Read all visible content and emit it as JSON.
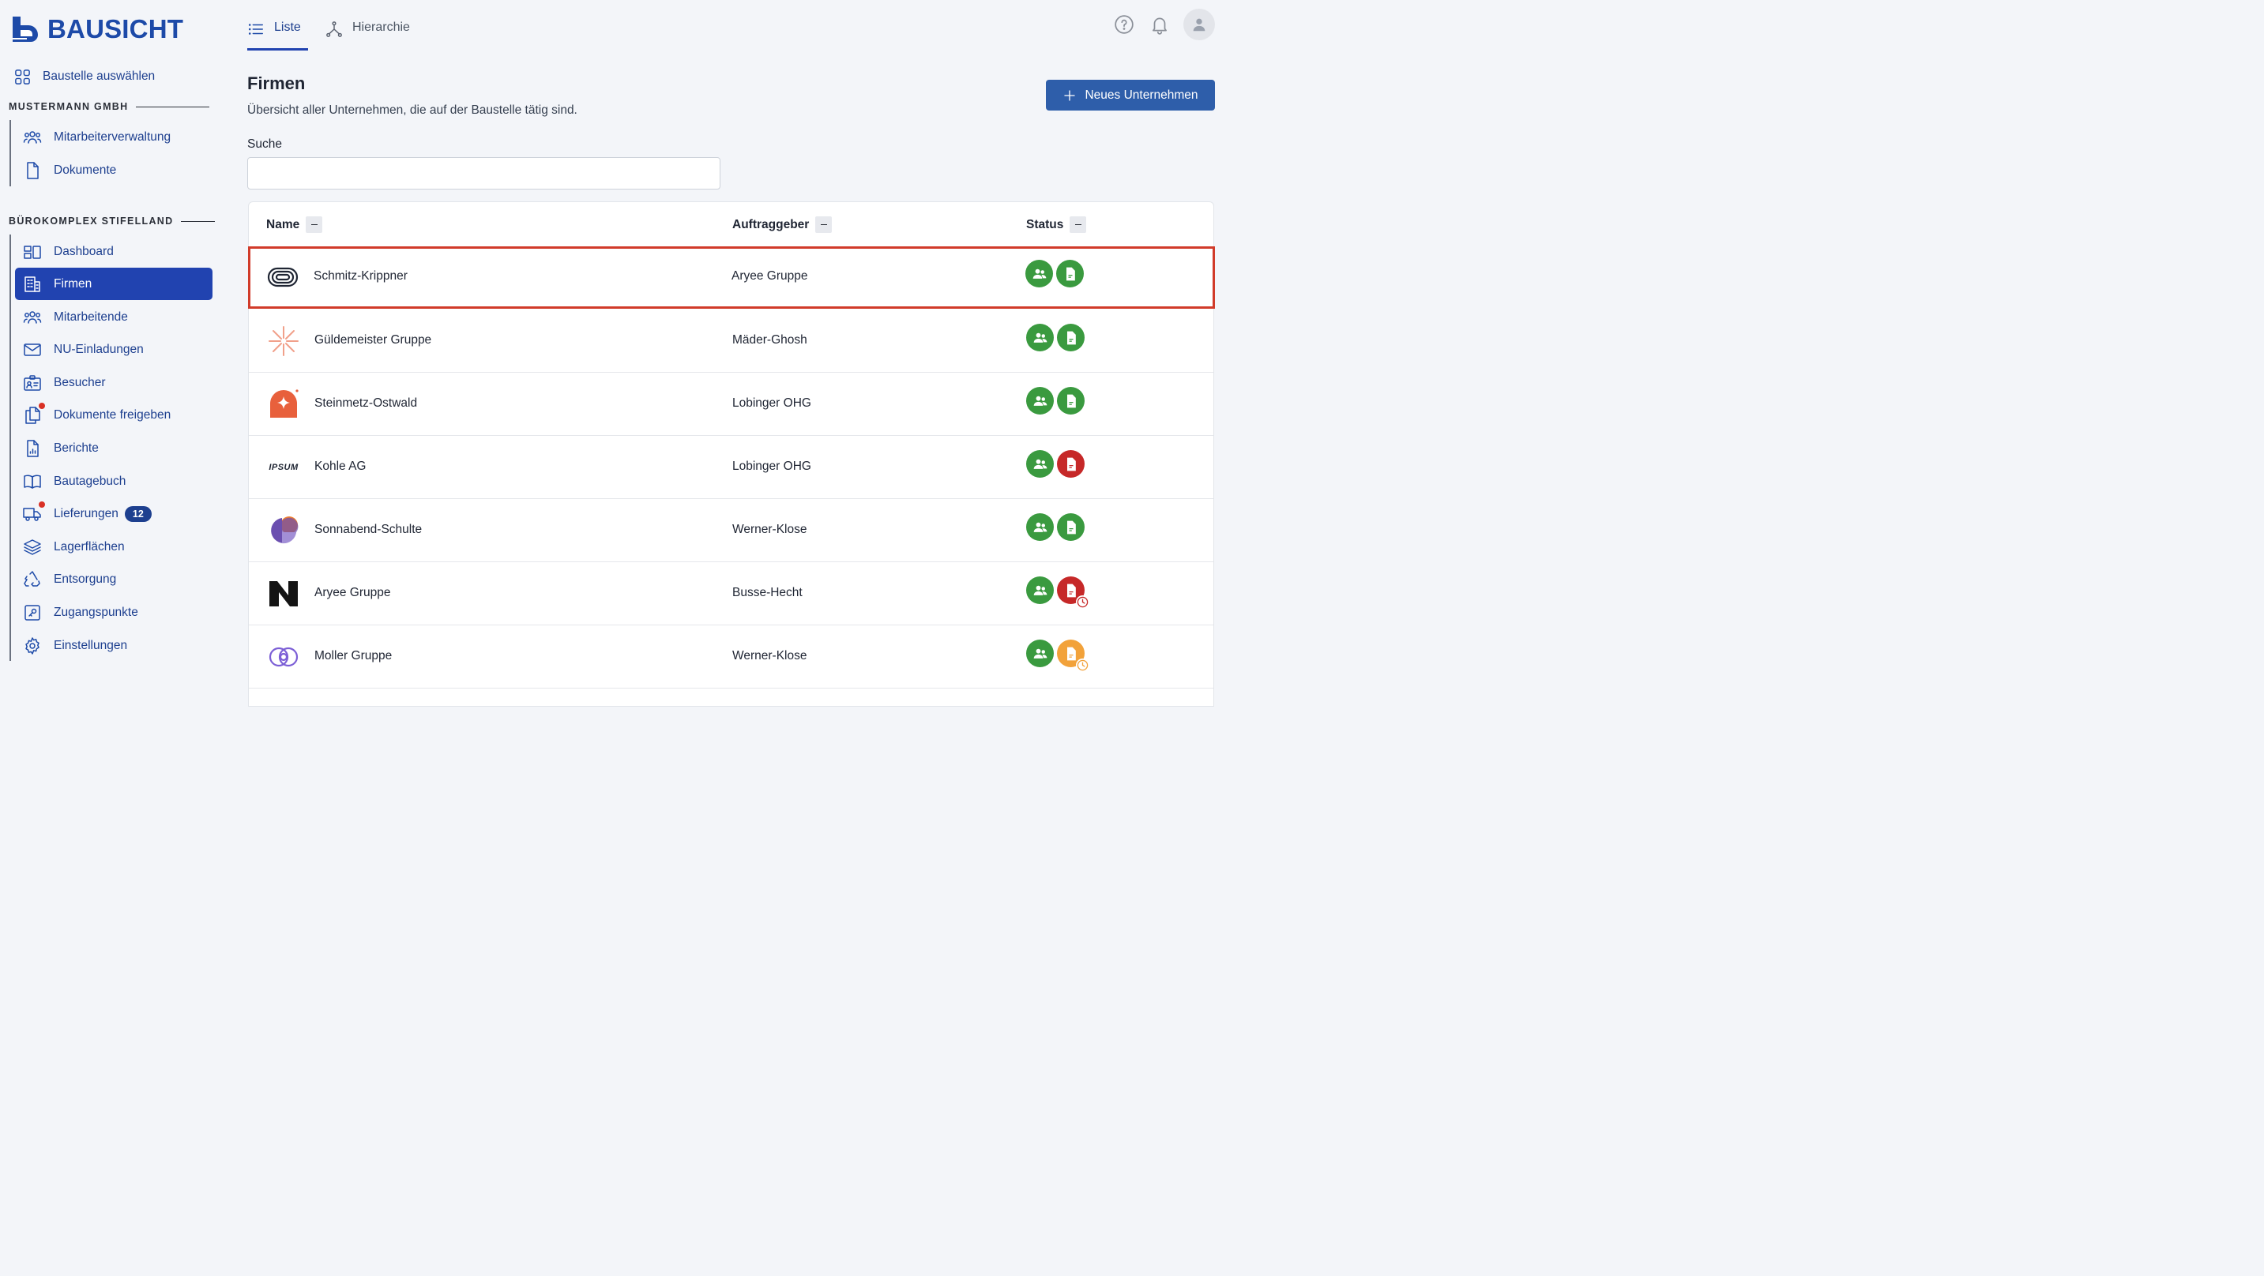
{
  "brand": {
    "name": "BAUSICHT",
    "color": "#1d4aa8"
  },
  "sidebar": {
    "select_site": "Baustelle auswählen",
    "org_section": {
      "label": "MUSTERMANN GMBH",
      "items": [
        {
          "label": "Mitarbeiterverwaltung",
          "icon": "users-icon"
        },
        {
          "label": "Dokumente",
          "icon": "document-icon"
        }
      ]
    },
    "site_section": {
      "label": "BÜROKOMPLEX STIFELLAND",
      "items": [
        {
          "label": "Dashboard",
          "icon": "dashboard-icon"
        },
        {
          "label": "Firmen",
          "icon": "building-icon",
          "active": true
        },
        {
          "label": "Mitarbeitende",
          "icon": "users-icon"
        },
        {
          "label": "NU-Einladungen",
          "icon": "mail-icon"
        },
        {
          "label": "Besucher",
          "icon": "visitor-badge-icon"
        },
        {
          "label": "Dokumente freigeben",
          "icon": "documents-icon",
          "notification_dot": true
        },
        {
          "label": "Berichte",
          "icon": "report-icon"
        },
        {
          "label": "Bautagebuch",
          "icon": "book-icon"
        },
        {
          "label": "Lieferungen",
          "icon": "truck-icon",
          "notification_dot": true,
          "badge": "12"
        },
        {
          "label": "Lagerflächen",
          "icon": "layers-icon"
        },
        {
          "label": "Entsorgung",
          "icon": "recycle-icon"
        },
        {
          "label": "Zugangspunkte",
          "icon": "key-icon"
        },
        {
          "label": "Einstellungen",
          "icon": "gear-icon"
        }
      ]
    }
  },
  "topbar": {
    "tabs": [
      {
        "label": "Liste",
        "icon": "list-icon",
        "active": true
      },
      {
        "label": "Hierarchie",
        "icon": "hierarchy-icon",
        "active": false
      }
    ],
    "icons": [
      "help-icon",
      "bell-icon",
      "avatar-icon"
    ]
  },
  "page": {
    "title": "Firmen",
    "subtitle": "Übersicht aller Unternehmen, die auf der Baustelle tätig sind.",
    "new_button": "Neues Unternehmen",
    "search_label": "Suche",
    "search_value": ""
  },
  "table": {
    "columns": [
      "Name",
      "Auftraggeber",
      "Status"
    ],
    "rows": [
      {
        "name": "Schmitz-Krippner",
        "client": "Aryee Gruppe",
        "logo": "rings-logo",
        "status_people": "green",
        "status_docs": "green",
        "highlighted": true
      },
      {
        "name": "Güldemeister Gruppe",
        "client": "Mäder-Ghosh",
        "logo": "starburst-logo",
        "status_people": "green",
        "status_docs": "green"
      },
      {
        "name": "Steinmetz-Ostwald",
        "client": "Lobinger OHG",
        "logo": "orange-sparkle-logo",
        "status_people": "green",
        "status_docs": "green"
      },
      {
        "name": "Kohle AG",
        "client": "Lobinger OHG",
        "logo": "ipsum-logo",
        "logo_text": "IPSUM",
        "status_people": "green",
        "status_docs": "red"
      },
      {
        "name": "Sonnabend-Schulte",
        "client": "Werner-Klose",
        "logo": "circles-logo",
        "status_people": "green",
        "status_docs": "green"
      },
      {
        "name": "Aryee Gruppe",
        "client": "Busse-Hecht",
        "logo": "n-logo",
        "status_people": "green",
        "status_docs": "red-pending"
      },
      {
        "name": "Moller Gruppe",
        "client": "Werner-Klose",
        "logo": "loop-logo",
        "status_people": "green",
        "status_docs": "orange-pending"
      }
    ]
  },
  "colors": {
    "accent": "#2143b0",
    "primary_button": "#2e5eaa",
    "status_green": "#3a9a3f",
    "status_red": "#c62828",
    "status_orange": "#f2a23a",
    "highlight_border": "#d13b2a"
  }
}
